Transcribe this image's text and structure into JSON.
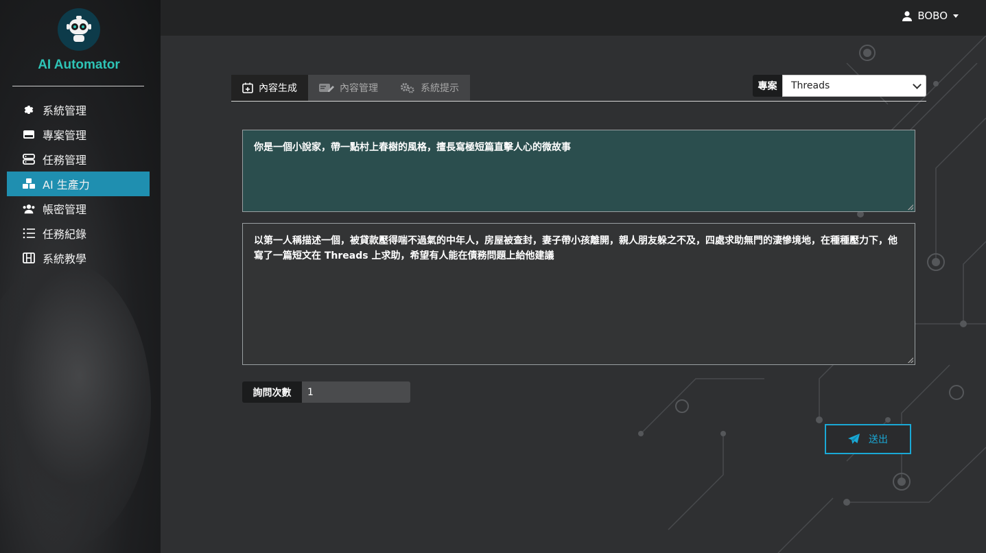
{
  "brand": {
    "name": "AI Automator"
  },
  "user": {
    "name": "BOBO"
  },
  "sidebar": {
    "items": [
      {
        "label": "系統管理",
        "icon": "gear-icon"
      },
      {
        "label": "專案管理",
        "icon": "drive-icon"
      },
      {
        "label": "任務管理",
        "icon": "server-icon"
      },
      {
        "label": "AI 生產力",
        "icon": "cubes-icon",
        "active": true
      },
      {
        "label": "帳密管理",
        "icon": "users-icon"
      },
      {
        "label": "任務紀錄",
        "icon": "list-icon"
      },
      {
        "label": "系統教學",
        "icon": "film-icon"
      }
    ]
  },
  "tabs": [
    {
      "label": "內容生成",
      "icon": "calendar-plus-icon",
      "active": true
    },
    {
      "label": "內容管理",
      "icon": "edit-icon"
    },
    {
      "label": "系統提示",
      "icon": "cogs-icon"
    }
  ],
  "project": {
    "label": "專案",
    "selected": "Threads"
  },
  "prompts": {
    "system": "你是一個小說家，帶一點村上春樹的風格，擅長寫極短篇直擊人心的微故事",
    "user": "以第一人稱描述一個，被貸款壓得喘不過氣的中年人，房屋被查封，妻子帶小孩離開，親人朋友躲之不及，四處求助無門的淒慘境地，在種種壓力下，他寫了一篇短文在 Threads 上求助，希望有人能在債務問題上給他建議"
  },
  "ask_count": {
    "label": "詢問次數",
    "value": "1"
  },
  "submit": {
    "label": "送出",
    "icon": "paper-plane-icon"
  },
  "colors": {
    "accent": "#1f8fb0",
    "brand": "#2ec4b6",
    "submit": "#1aa9d6",
    "system_prompt_bg": "#2b4e4e"
  }
}
